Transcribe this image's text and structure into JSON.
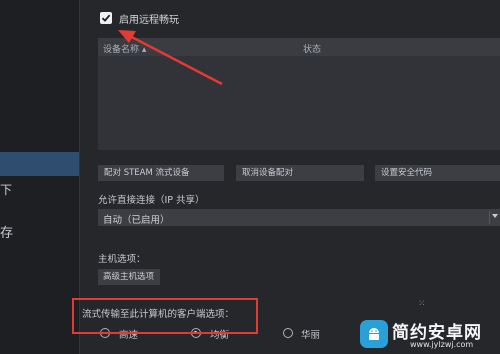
{
  "sidebar": {
    "partial_labels": [
      "下",
      "存"
    ]
  },
  "checkbox": {
    "label": "启用远程畅玩",
    "checked": true
  },
  "device_table": {
    "columns": [
      "设备名称 ▴",
      "状态"
    ]
  },
  "buttons": {
    "pair_steam": "配对 STEAM 流式设备",
    "unpair": "取消设备配对",
    "security_code": "设置安全代码"
  },
  "direct_connect": {
    "label": "允许直接连接（IP 共享）",
    "value": "自动（已启用）"
  },
  "host_options": {
    "label": "主机选项：",
    "advanced_button": "高级主机选项"
  },
  "client_options": {
    "label": "流式传输至此计算机的客户端选项：",
    "options": [
      {
        "label": "高速",
        "selected": false
      },
      {
        "label": "均衡",
        "selected": true
      },
      {
        "label": "华丽",
        "selected": false
      }
    ]
  },
  "watermark": {
    "title": "简约安卓网",
    "url": "www.jylzwj.com"
  },
  "colors": {
    "background": "#26272b",
    "accent_red": "#e23b36",
    "selection_blue": "#2f4e6f"
  }
}
